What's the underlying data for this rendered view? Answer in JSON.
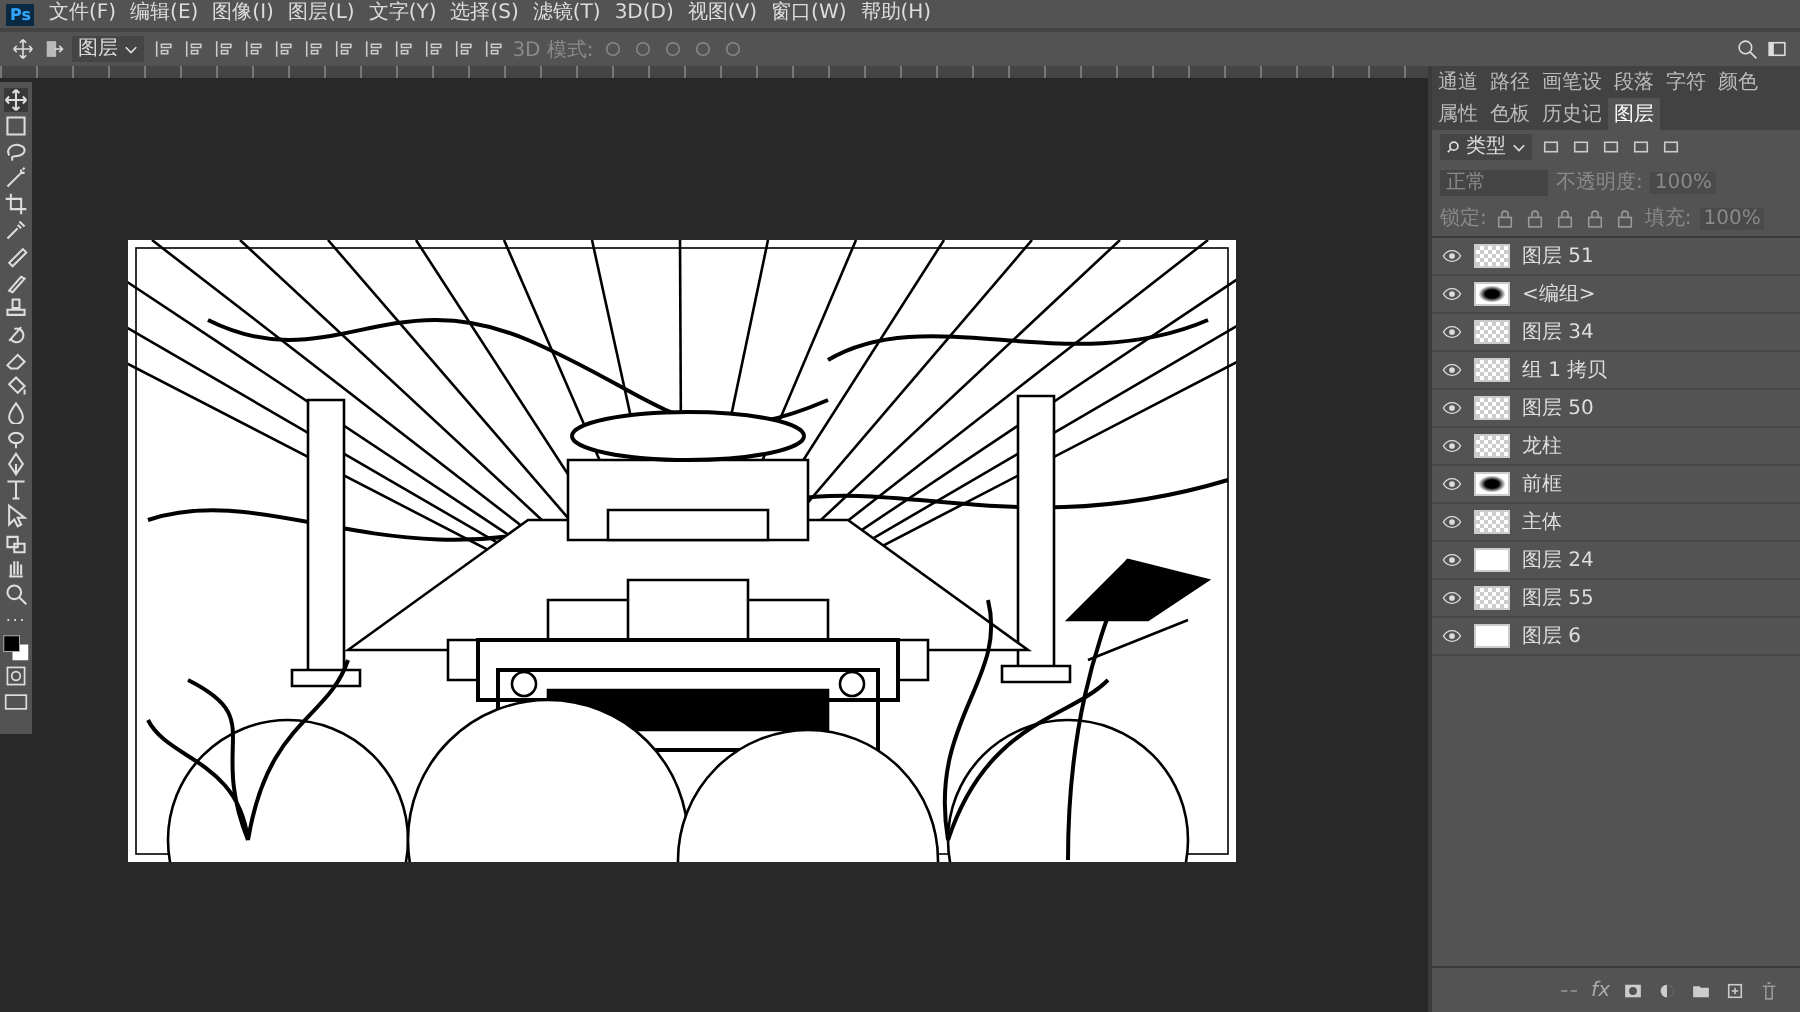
{
  "app_logo": "Ps",
  "menu": [
    "文件(F)",
    "编辑(E)",
    "图像(I)",
    "图层(L)",
    "文字(Y)",
    "选择(S)",
    "滤镜(T)",
    "3D(D)",
    "视图(V)",
    "窗口(W)",
    "帮助(H)"
  ],
  "options_bar": {
    "auto_select_target": "图层",
    "mode_3d": "3D 模式:"
  },
  "tools": [
    {
      "kind": "move",
      "selected": true
    },
    {
      "kind": "marquee",
      "selected": false
    },
    {
      "kind": "lasso",
      "selected": false
    },
    {
      "kind": "wand",
      "selected": false
    },
    {
      "kind": "crop",
      "selected": false
    },
    {
      "kind": "eyedropper",
      "selected": false
    },
    {
      "kind": "bandage",
      "selected": false
    },
    {
      "kind": "brush",
      "selected": false
    },
    {
      "kind": "stamp",
      "selected": false
    },
    {
      "kind": "history",
      "selected": false
    },
    {
      "kind": "eraser",
      "selected": false
    },
    {
      "kind": "bucket",
      "selected": false
    },
    {
      "kind": "blur",
      "selected": false
    },
    {
      "kind": "dodge",
      "selected": false
    },
    {
      "kind": "pen",
      "selected": false
    },
    {
      "kind": "type",
      "selected": false
    },
    {
      "kind": "pointer",
      "selected": false
    },
    {
      "kind": "shape",
      "selected": false
    },
    {
      "kind": "hand",
      "selected": false
    },
    {
      "kind": "zoom",
      "selected": false
    },
    {
      "kind": "more",
      "selected": false
    }
  ],
  "panel_tabs": [
    {
      "label": "通道",
      "selected": false
    },
    {
      "label": "路径",
      "selected": false
    },
    {
      "label": "画笔设",
      "selected": false
    },
    {
      "label": "段落",
      "selected": false
    },
    {
      "label": "字符",
      "selected": false
    },
    {
      "label": "颜色",
      "selected": false
    },
    {
      "label": "属性",
      "selected": false
    },
    {
      "label": "色板",
      "selected": false
    },
    {
      "label": "历史记",
      "selected": false
    },
    {
      "label": "图层",
      "selected": true
    }
  ],
  "layers_panel": {
    "filter": "类型",
    "blend_mode": "正常",
    "opacity_label": "不透明度:",
    "opacity": "100%",
    "lock_label": "锁定:",
    "fill_label": "填充:",
    "fill": "100%",
    "fx": "fx"
  },
  "layers": [
    {
      "name": "图层 51",
      "visible": true,
      "kind": "transparent"
    },
    {
      "name": "<编组>",
      "visible": true,
      "kind": "art"
    },
    {
      "name": "图层 34",
      "visible": true,
      "kind": "transparent"
    },
    {
      "name": "组 1 拷贝",
      "visible": true,
      "kind": "transparent"
    },
    {
      "name": "图层 50",
      "visible": true,
      "kind": "transparent"
    },
    {
      "name": "龙柱",
      "visible": true,
      "kind": "transparent"
    },
    {
      "name": "前框",
      "visible": true,
      "kind": "art"
    },
    {
      "name": "主体",
      "visible": true,
      "kind": "transparent"
    },
    {
      "name": "图层 24",
      "visible": true,
      "kind": "white"
    },
    {
      "name": "图层 55",
      "visible": true,
      "kind": "transparent"
    },
    {
      "name": "图层 6",
      "visible": true,
      "kind": "white"
    }
  ]
}
